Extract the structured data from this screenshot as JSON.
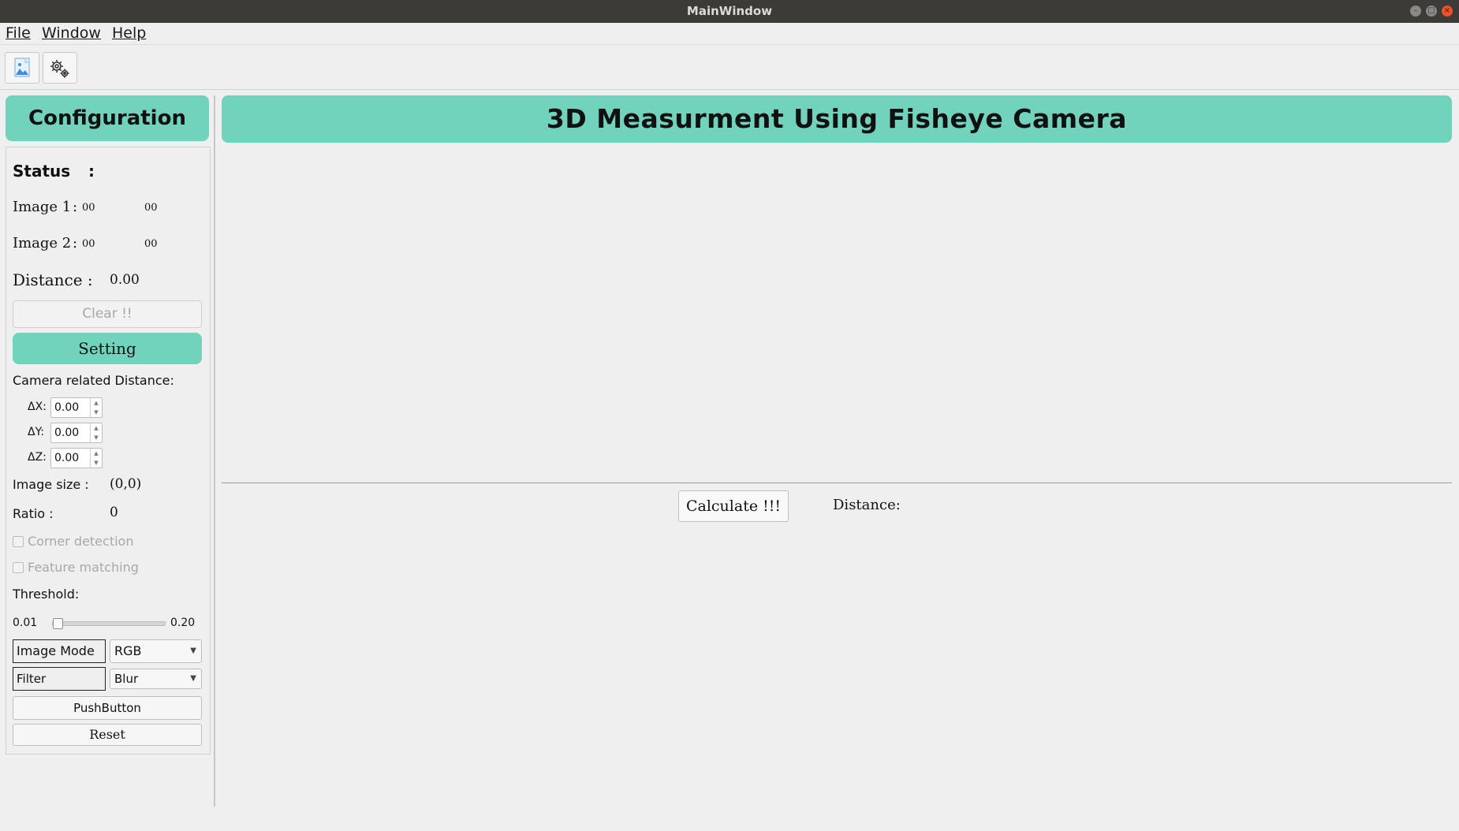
{
  "window": {
    "title": "MainWindow"
  },
  "menu": {
    "items": [
      "File",
      "Window",
      "Help"
    ]
  },
  "toolbar": {
    "icons": [
      "image-icon",
      "settings-gears-icon"
    ]
  },
  "config": {
    "header": "Configuration",
    "status_label": "Status",
    "status_colon": ":",
    "image1": {
      "label": "Image 1",
      "colon": ":",
      "x": "00",
      "y": "00"
    },
    "image2": {
      "label": "Image 2",
      "colon": ":",
      "x": "00",
      "y": "00"
    },
    "distance": {
      "label": "Distance :",
      "value": "0.00"
    },
    "clear_button": "Clear !!",
    "setting_button": "Setting",
    "camera_distance_label": "Camera related Distance:",
    "dx": {
      "label": "ΔX:",
      "value": "0.00"
    },
    "dy": {
      "label": "ΔY:",
      "value": "0.00"
    },
    "dz": {
      "label": "ΔZ:",
      "value": "0.00"
    },
    "image_size": {
      "label": "Image size :",
      "value": "(0,0)"
    },
    "ratio": {
      "label": "Ratio :",
      "value": "0"
    },
    "corner_detection": {
      "label": "Corner detection",
      "checked": false
    },
    "feature_matching": {
      "label": "Feature matching",
      "checked": false
    },
    "threshold": {
      "label": "Threshold:",
      "min": "0.01",
      "max": "0.20",
      "value": 0.01
    },
    "image_mode": {
      "label": "Image Mode",
      "selected": "RGB"
    },
    "filter": {
      "label": "Filter",
      "selected": "Blur"
    },
    "push_button": "PushButton",
    "reset_button": "Reset"
  },
  "main": {
    "header": "3D Measurment Using Fisheye Camera",
    "calculate_button": "Calculate !!!",
    "distance_label": "Distance:"
  },
  "colors": {
    "accent": "#72d3bc",
    "titlebar": "#3c3b37",
    "close": "#e9542c"
  }
}
